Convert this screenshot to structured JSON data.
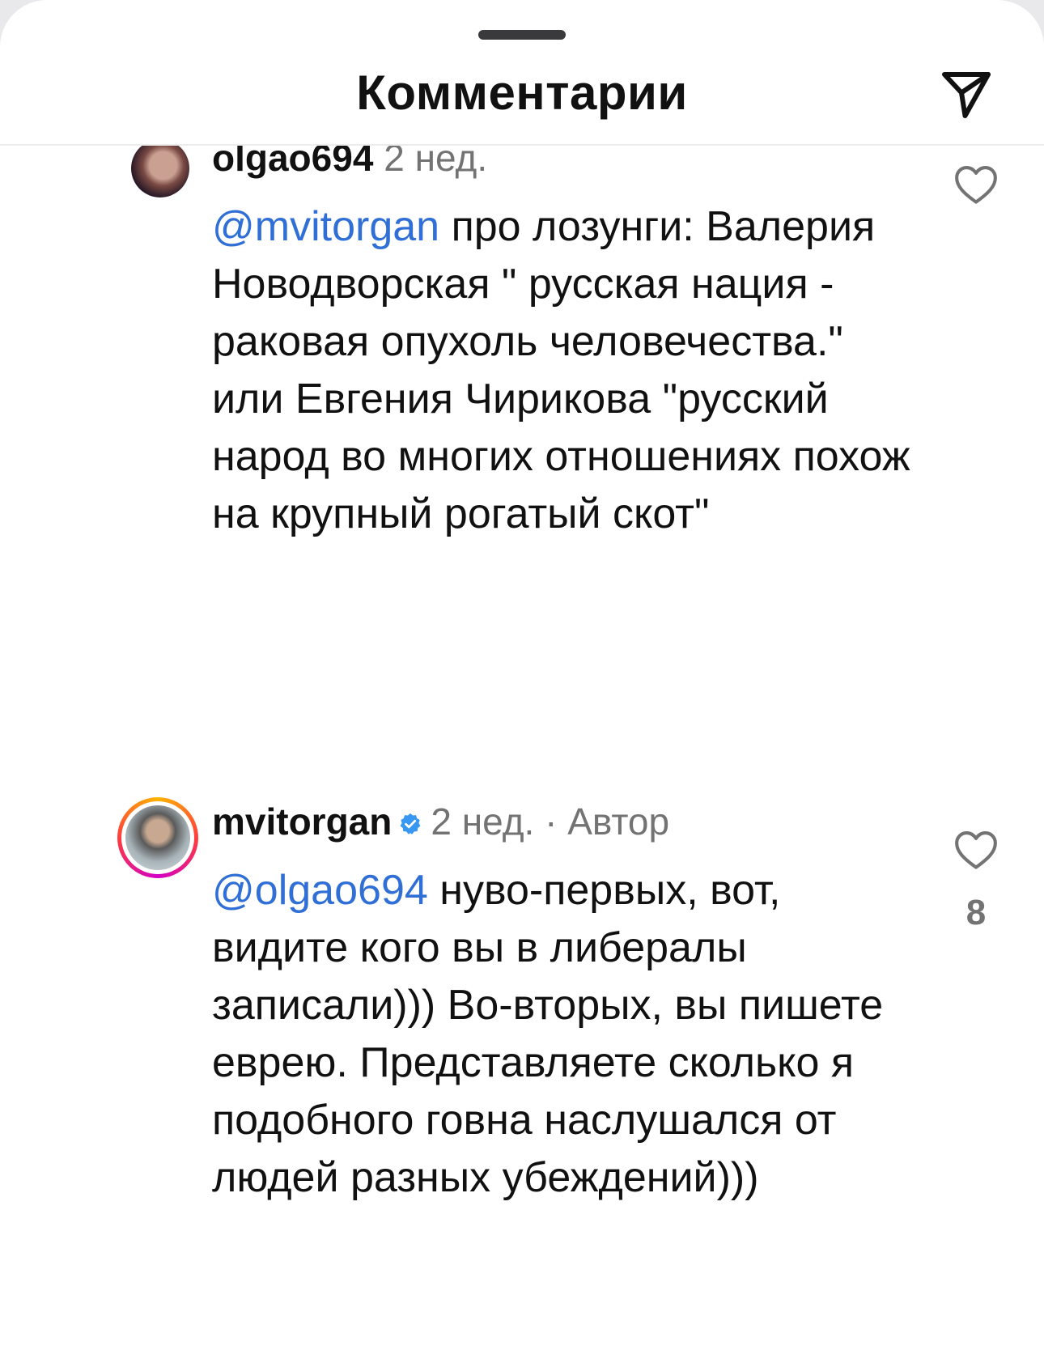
{
  "header": {
    "title": "Комментарии",
    "share_icon": "paper-plane-icon"
  },
  "comments": [
    {
      "username": "olgao694",
      "time": "2 нед.",
      "mention": "@mvitorgan",
      "text": "про лозунги: Валерия Новодворская \" русская нация - раковая опухоль человечества.\" или Евгения Чирикова \"русский народ во многих отношениях похож на крупный рогатый скот\"",
      "verified": false,
      "like_icon": "heart-outline-icon",
      "like_count": ""
    },
    {
      "username": "mvitorgan",
      "time": "2 нед. · Автор",
      "mention": "@olgao694",
      "text": "нуво-первых, вот, видите кого вы в либералы записали))) Во-вторых, вы пишете еврею. Представляете сколько я подобного говна наслушался от людей разных убеждений)))",
      "verified": true,
      "like_icon": "heart-outline-icon",
      "like_count": "8"
    }
  ],
  "colors": {
    "mention": "#2f6fd6",
    "muted": "#737373",
    "verified": "#3897f0"
  }
}
